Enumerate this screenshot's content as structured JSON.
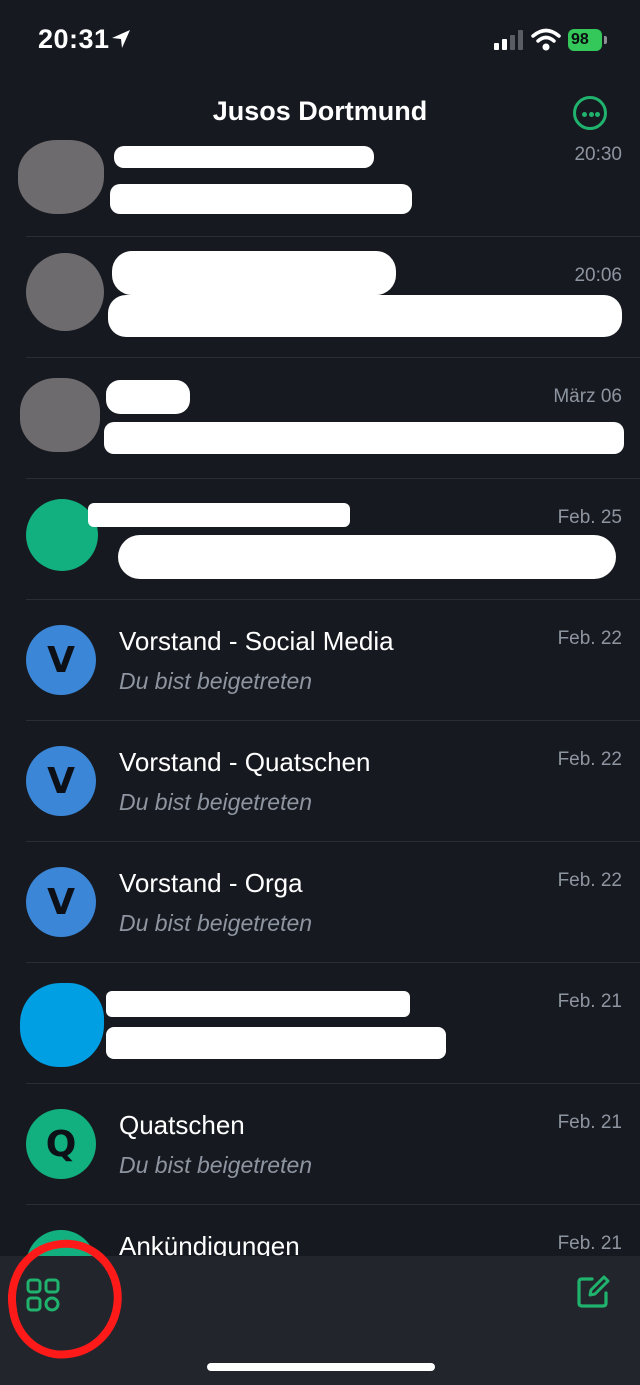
{
  "status": {
    "time": "20:31",
    "battery": "98"
  },
  "header": {
    "title": "Jusos Dortmund"
  },
  "chats": [
    {
      "date": "20:30",
      "avatar_color": "#6e6b6e"
    },
    {
      "date": "20:06",
      "avatar_color": "#6e6b6e"
    },
    {
      "date": "März 06",
      "avatar_color": "#6e6b6e"
    },
    {
      "date": "Feb. 25",
      "avatar_color": "#12b07f"
    },
    {
      "name": "Vorstand - Social Media",
      "preview": "Du bist beigetreten",
      "date": "Feb. 22",
      "initial": "V",
      "avatar_color": "#3b86d6"
    },
    {
      "name": "Vorstand - Quatschen",
      "preview": "Du bist beigetreten",
      "date": "Feb. 22",
      "initial": "V",
      "avatar_color": "#3b86d6"
    },
    {
      "name": "Vorstand - Orga",
      "preview": "Du bist beigetreten",
      "date": "Feb. 22",
      "initial": "V",
      "avatar_color": "#3b86d6"
    },
    {
      "date": "Feb. 21",
      "avatar_color": "#009ee3"
    },
    {
      "name": "Quatschen",
      "preview": "Du bist beigetreten",
      "date": "Feb. 21",
      "initial": "Q",
      "avatar_color": "#12b07f"
    },
    {
      "name": "Ankündigungen",
      "date": "Feb. 21",
      "avatar_color": "#12b07f"
    }
  ],
  "tab_bar": {
    "left_icon": "apps-grid-icon",
    "right_icon": "compose-icon"
  },
  "colors": {
    "accent": "#20b36d",
    "background": "#161a20",
    "annotation": "#ff1a1a"
  }
}
